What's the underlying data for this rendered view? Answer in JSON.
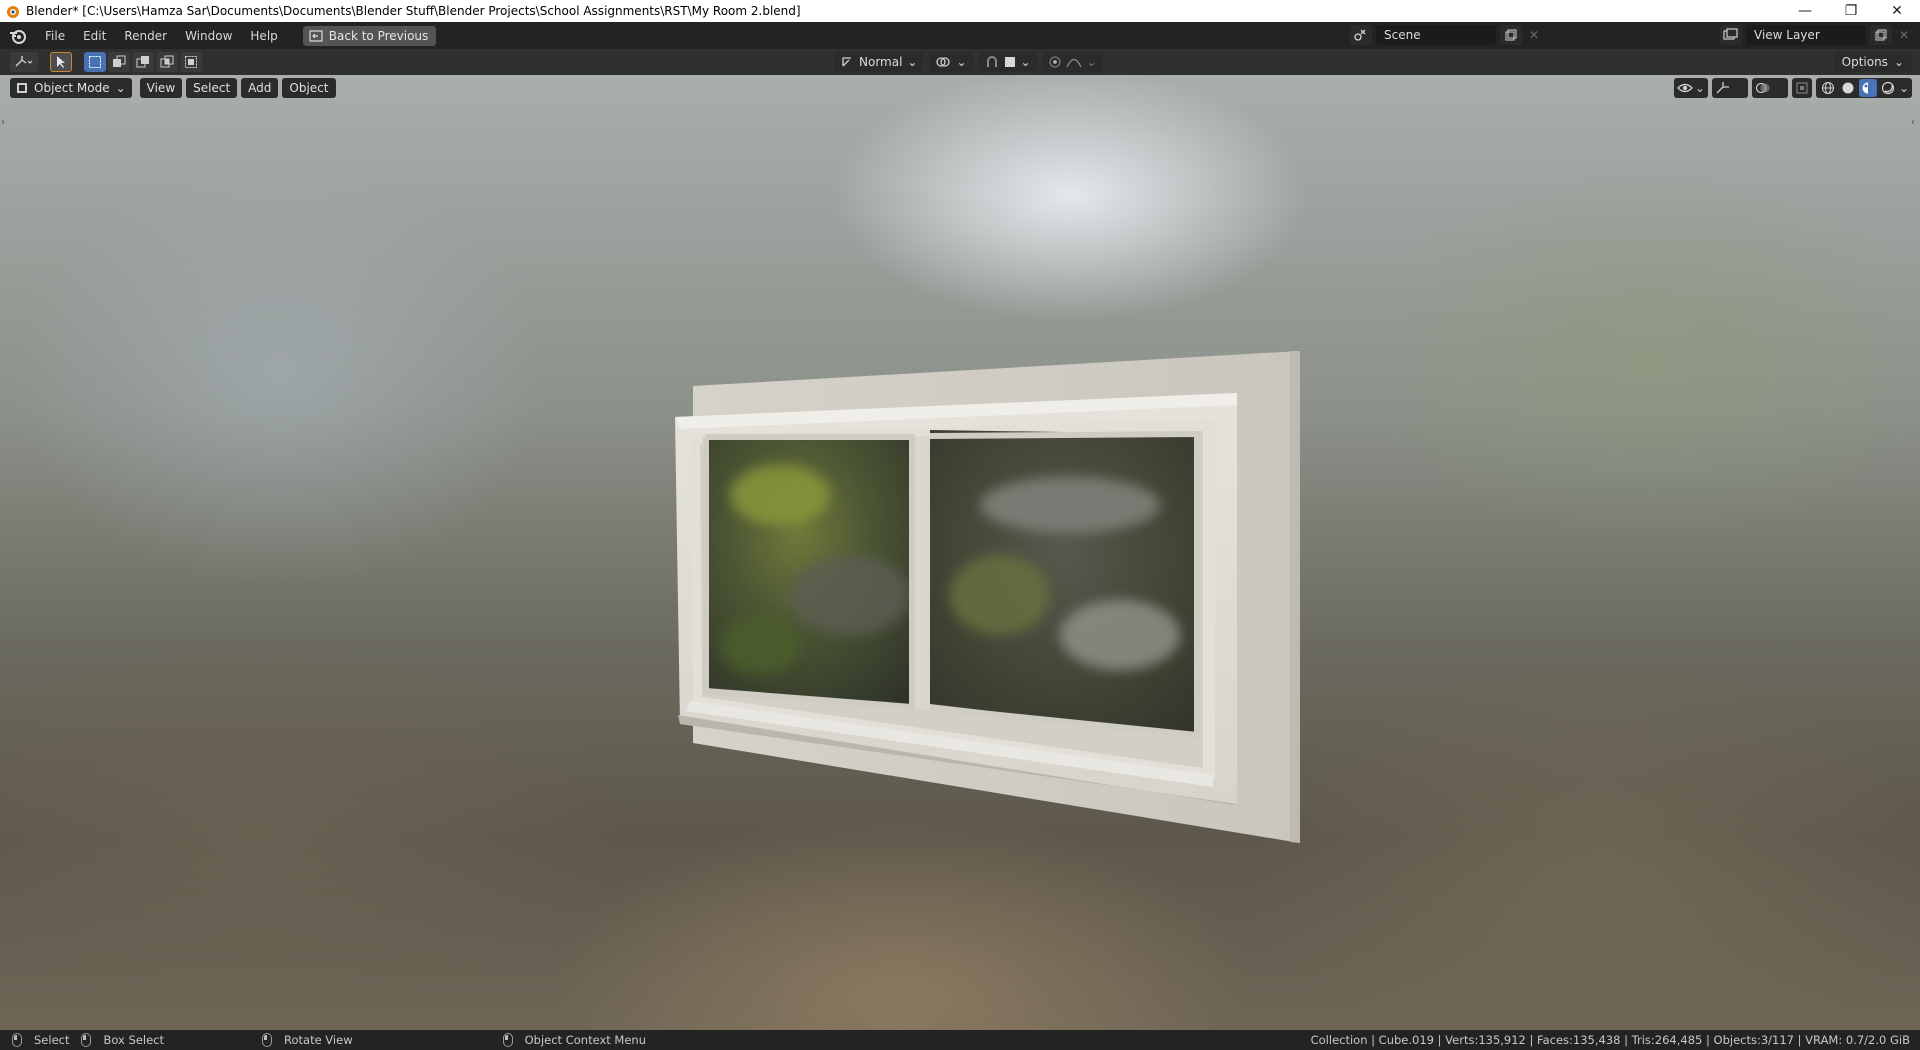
{
  "titlebar": {
    "title": "Blender* [C:\\Users\\Hamza Sar\\Documents\\Documents\\Blender Stuff\\Blender Projects\\School Assignments\\RST\\My Room 2.blend]",
    "minimize": "—",
    "restore": "❐",
    "close": "✕"
  },
  "menubar": {
    "items": [
      "File",
      "Edit",
      "Render",
      "Window",
      "Help"
    ],
    "back_button": "Back to Previous",
    "scene_value": "Scene",
    "view_layer_value": "View Layer"
  },
  "toolheader": {
    "orientation": "Normal",
    "options": "Options"
  },
  "viewport_header": {
    "mode": "Object Mode",
    "menus": [
      "View",
      "Select",
      "Add",
      "Object"
    ]
  },
  "statusbar": {
    "select": "Select",
    "box_select": "Box Select",
    "rotate_view": "Rotate View",
    "context_menu": "Object Context Menu",
    "stats": "Collection | Cube.019 | Verts:135,912 | Faces:135,438 | Tris:264,485 | Objects:3/117 | VRAM: 0.7/2.0 GiB"
  },
  "colors": {
    "accent": "#4772b3",
    "header_bg": "#303030",
    "statusbar_bg": "#232323",
    "window_frame": "#e4e1da"
  }
}
